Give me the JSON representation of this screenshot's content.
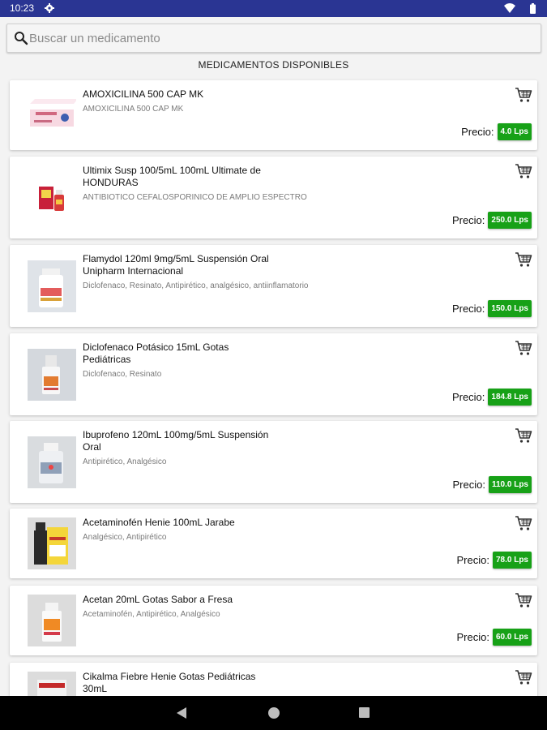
{
  "status_bar": {
    "time": "10:23",
    "icons": [
      "gear-icon",
      "wifi-icon",
      "battery-icon"
    ]
  },
  "search": {
    "placeholder": "Buscar un medicamento",
    "value": "",
    "icon": "search-icon"
  },
  "list_title": "MEDICAMENTOS DISPONIBLES",
  "price_label": "Precio:",
  "colors": {
    "status_bar": "#2a3593",
    "price_badge": "#17a117",
    "background": "#f3f3f3"
  },
  "products": [
    {
      "name": "AMOXICILINA 500 CAP MK",
      "description": "AMOXICILINA 500 CAP MK",
      "price": "4.0 Lps",
      "image": "amoxicilina-box-image"
    },
    {
      "name": "Ultimix Susp 100/5mL  100mL Ultimate de HONDURAS",
      "description": "ANTIBIOTICO CEFALOSPORINICO DE AMPLIO ESPECTRO",
      "price": "250.0 Lps",
      "image": "ultimix-bottle-image"
    },
    {
      "name": "Flamydol 120ml 9mg/5mL Suspensión Oral Unipharm Internacional",
      "description": "Diclofenaco, Resinato, Antipirético, analgésico, antiinflamatorio",
      "price": "150.0 Lps",
      "image": "flamydol-bottle-image"
    },
    {
      "name": "Diclofenaco Potásico 15mL Gotas Pediátricas",
      "description": "Diclofenaco, Resinato",
      "price": "184.8 Lps",
      "image": "diclofenaco-bottle-image"
    },
    {
      "name": "Ibuprofeno 120mL 100mg/5mL Suspensión Oral",
      "description": "Antipirético, Analgésico",
      "price": "110.0 Lps",
      "image": "ibuprofeno-bottle-image"
    },
    {
      "name": "Acetaminofén Henie 100mL Jarabe",
      "description": "Analgésico, Antipirético",
      "price": "78.0 Lps",
      "image": "acetaminofen-box-image"
    },
    {
      "name": "Acetan 20mL Gotas Sabor a Fresa",
      "description": "Acetaminofén, Antipirético, Analgésico",
      "price": "60.0 Lps",
      "image": "acetan-bottle-image"
    },
    {
      "name": "Cikalma Fiebre Henie Gotas Pediátricas 30mL",
      "description": "",
      "price": "",
      "image": "cikalma-box-image"
    }
  ],
  "nav_bar": {
    "icons": [
      "back-icon",
      "home-icon",
      "recents-icon"
    ]
  }
}
